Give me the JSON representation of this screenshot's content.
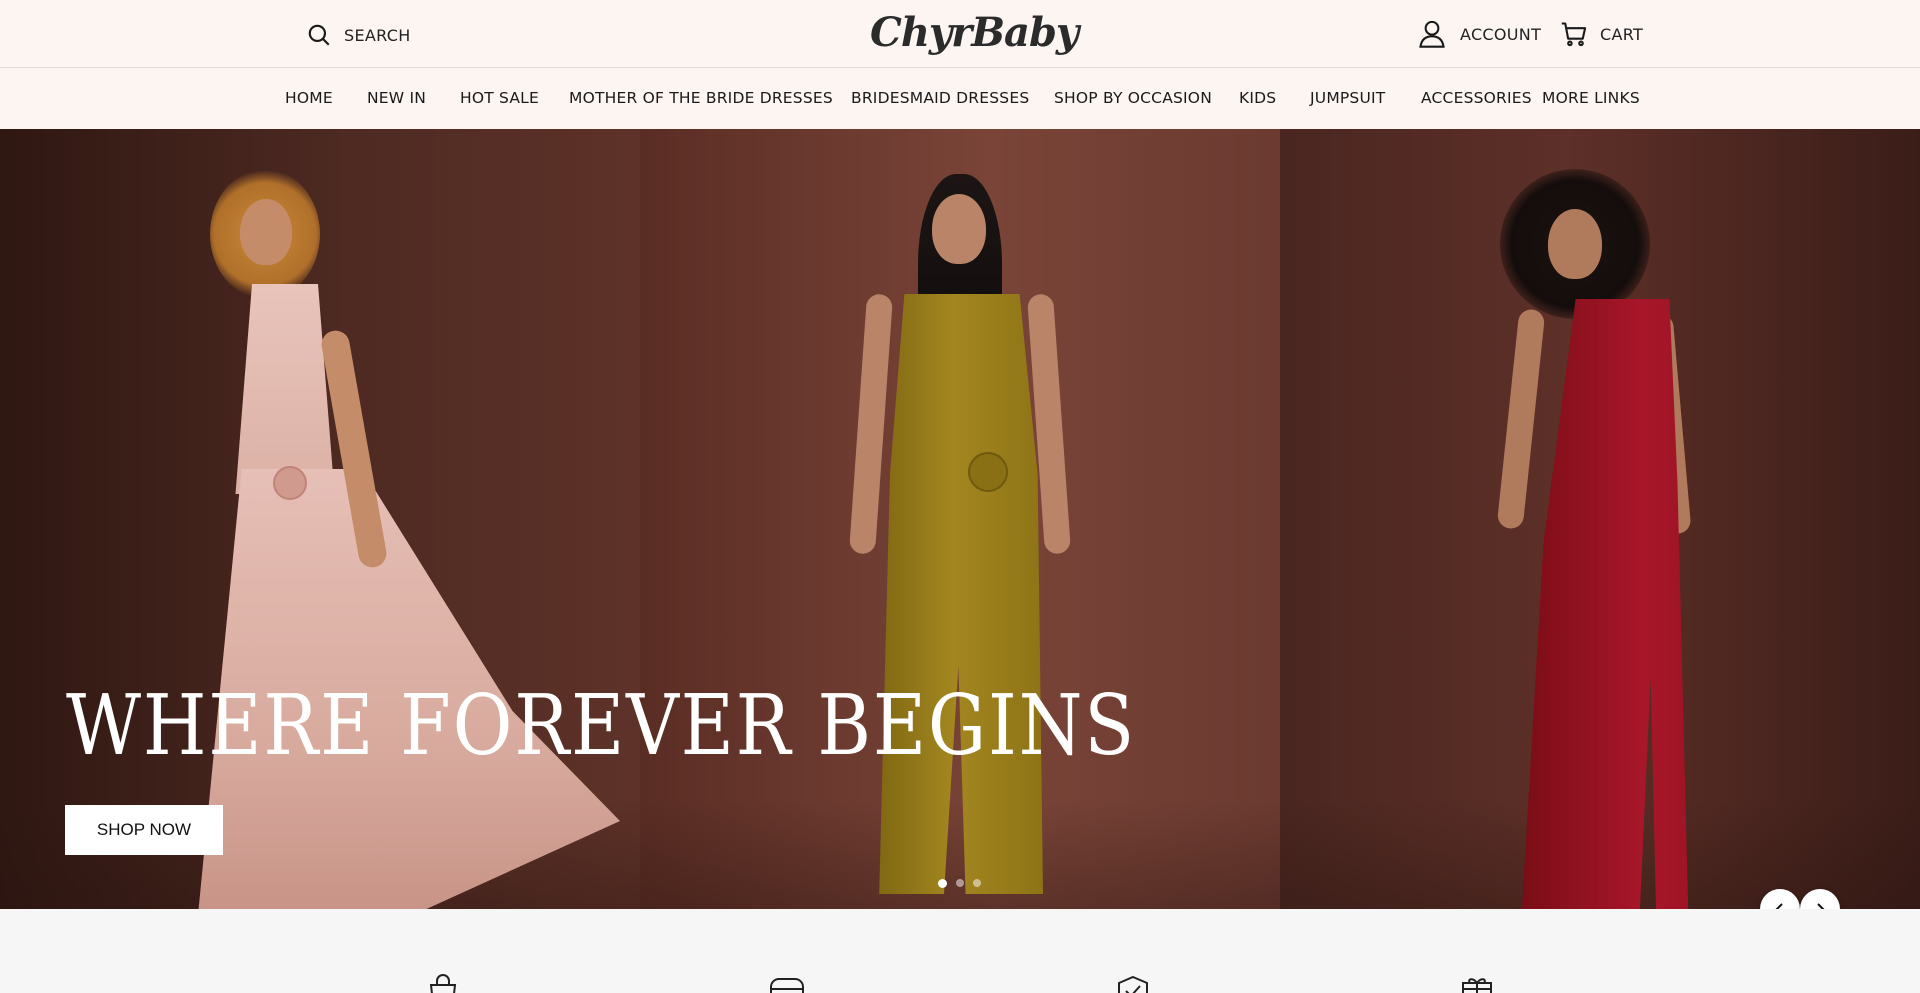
{
  "header": {
    "search_label": "SEARCH",
    "logo_text": "ChyrBaby",
    "account_label": "ACCOUNT",
    "cart_label": "CART"
  },
  "nav": {
    "items": [
      "HOME",
      "NEW IN",
      "HOT SALE",
      "MOTHER OF THE BRIDE DRESSES",
      "BRIDESMAID DRESSES",
      "SHOP BY OCCASION",
      "KIDS",
      "JUMPSUIT",
      "ACCESSORIES",
      "MORE LINKS"
    ]
  },
  "hero": {
    "headline": "WHERE FOREVER BEGINS",
    "cta_label": "SHOP NOW",
    "slide_count": 3,
    "active_slide": 1,
    "models": [
      {
        "dress_color": "#e4bcb3",
        "dress": "blush pink v-neck gown with rosette"
      },
      {
        "dress_color": "#9a7f1c",
        "dress": "olive wrap dress with rosette"
      },
      {
        "dress_color": "#9c1420",
        "dress": "red one-shoulder gown"
      }
    ]
  },
  "features": {
    "icons": [
      "shopping-bag-icon",
      "payment-card-icon",
      "shield-check-icon",
      "gift-box-icon"
    ]
  },
  "colors": {
    "header_bg": "#fcf5f2",
    "hero_bg": "#5a2e24",
    "cta_bg": "#ffffff",
    "page_bg": "#f6f6f6"
  }
}
